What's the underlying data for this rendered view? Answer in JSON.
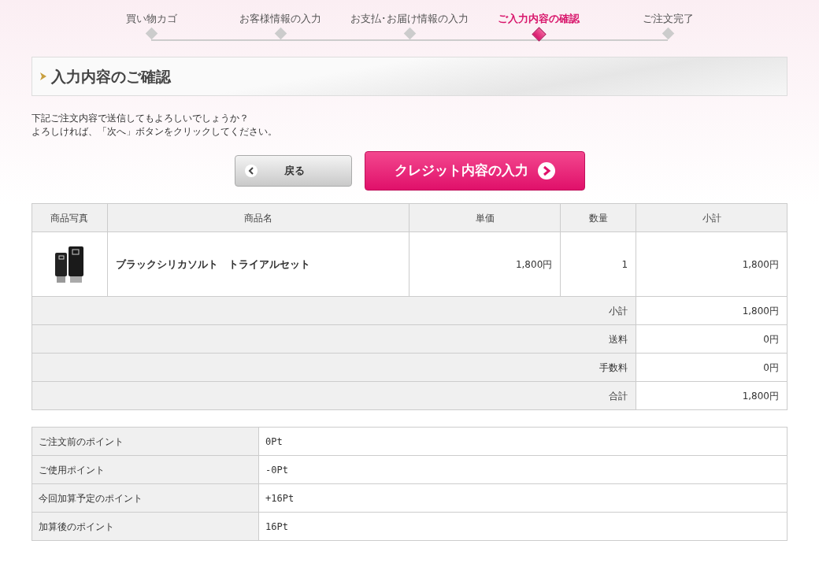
{
  "steps": [
    {
      "label": "買い物カゴ",
      "selected": false
    },
    {
      "label": "お客様情報の入力",
      "selected": false
    },
    {
      "label": "お支払･お届け情報の入力",
      "selected": false
    },
    {
      "label": "ご入力内容の確認",
      "selected": true
    },
    {
      "label": "ご注文完了",
      "selected": false
    }
  ],
  "heading": "入力内容のご確認",
  "message": [
    "下記ご注文内容で送信してもよろしいでしょうか？",
    "よろしければ、「次へ」ボタンをクリックしてください。"
  ],
  "buttons": {
    "back": "戻る",
    "next": "クレジット内容の入力"
  },
  "order_table": {
    "columns": [
      "商品写真",
      "商品名",
      "単価",
      "数量",
      "小計"
    ],
    "rows": [
      {
        "name": "ブラックシリカソルト　トライアルセット",
        "unit_price": "1,800円",
        "quantity": "1",
        "subtotal": "1,800円"
      }
    ],
    "totals": [
      {
        "label": "小計",
        "value": "1,800円"
      },
      {
        "label": "送料",
        "value": "0円"
      },
      {
        "label": "手数料",
        "value": "0円"
      },
      {
        "label": "合計",
        "value": "1,800円"
      }
    ]
  },
  "points": [
    {
      "label": "ご注文前のポイント",
      "value": "0Pt"
    },
    {
      "label": "ご使用ポイント",
      "value": "-0Pt"
    },
    {
      "label": "今回加算予定のポイント",
      "value": "+16Pt"
    },
    {
      "label": "加算後のポイント",
      "value": "16Pt"
    }
  ]
}
